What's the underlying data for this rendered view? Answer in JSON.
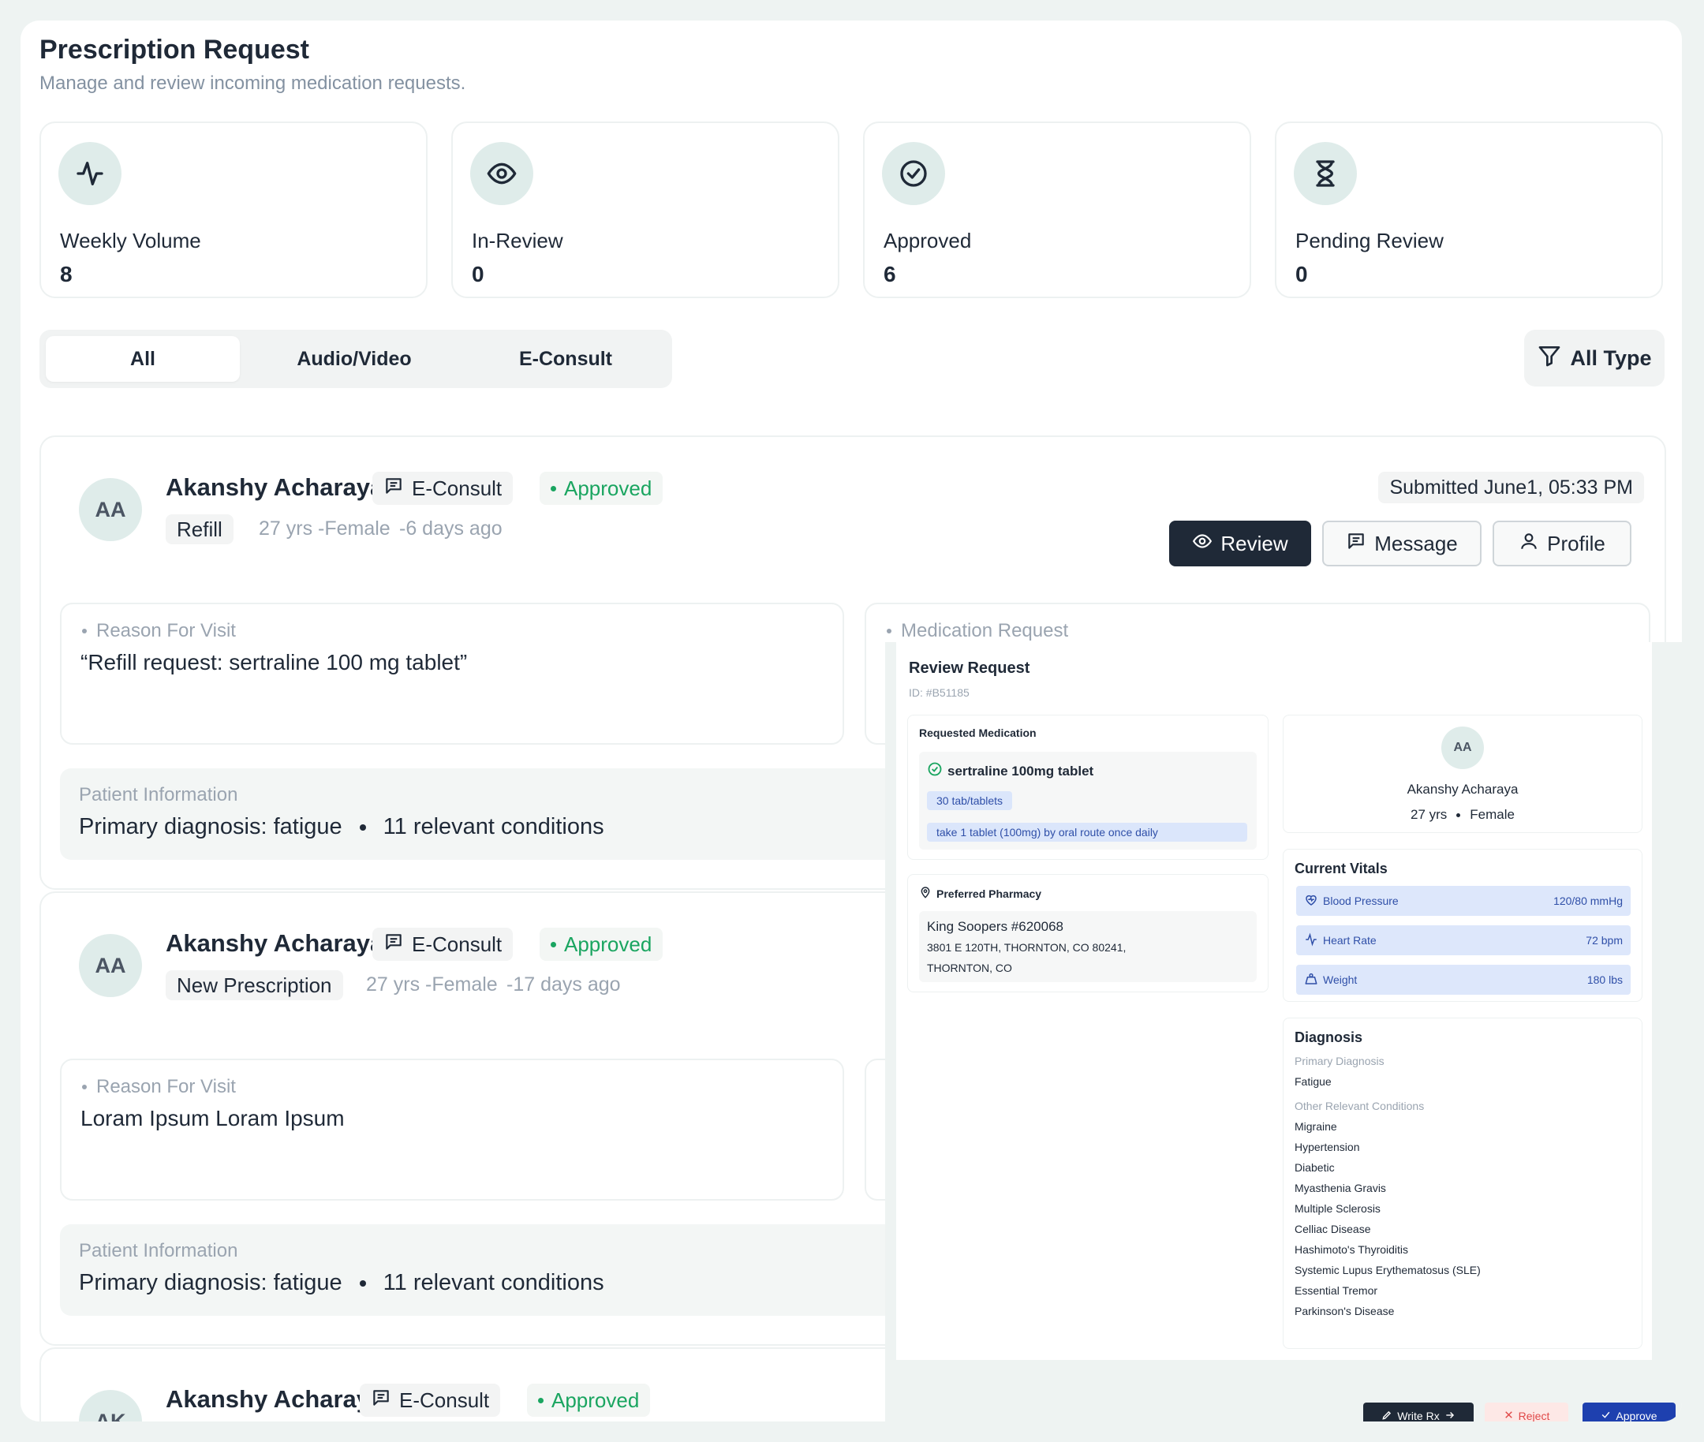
{
  "header": {
    "title": "Prescription Request",
    "subtitle": "Manage and review incoming medication requests."
  },
  "stats": [
    {
      "icon": "activity-icon",
      "label": "Weekly Volume",
      "value": "8"
    },
    {
      "icon": "eye-icon",
      "label": "In-Review",
      "value": "0"
    },
    {
      "icon": "check-circle-icon",
      "label": "Approved",
      "value": "6"
    },
    {
      "icon": "hourglass-icon",
      "label": "Pending Review",
      "value": "0"
    }
  ],
  "tabs": [
    "All",
    "Audio/Video",
    "E-Consult"
  ],
  "active_tab": "All",
  "filter_label": "All Type",
  "requests": [
    {
      "initials": "AA",
      "name": "Akanshy Acharaya",
      "consult_type": "E-Consult",
      "status": "Approved",
      "request_type": "Refill",
      "demographics": "27 yrs -Female",
      "age_ago": "-6 days ago",
      "submitted": "Submitted June1, 05:33 PM",
      "buttons": {
        "review": "Review",
        "message": "Message",
        "profile": "Profile"
      },
      "reason_label": "Reason For Visit",
      "reason": "“Refill request: sertraline 100 mg tablet”",
      "medication_label": "Medication Request",
      "patient_info_label": "Patient Information",
      "primary_diagnosis": "Primary diagnosis: fatigue",
      "conditions": "11 relevant conditions"
    },
    {
      "initials": "AA",
      "name": "Akanshy Acharaya",
      "consult_type": "E-Consult",
      "status": "Approved",
      "request_type": "New Prescription",
      "demographics": "27 yrs -Female",
      "age_ago": "-17 days ago",
      "reason_label": "Reason For Visit",
      "reason": "Loram Ipsum Loram Ipsum",
      "patient_info_label": "Patient Information",
      "primary_diagnosis": "Primary diagnosis: fatigue",
      "conditions": "11 relevant conditions"
    },
    {
      "initials": "AK",
      "name": "Akanshy Acharay",
      "consult_type": "E-Consult",
      "status": "Approved"
    }
  ],
  "review_panel": {
    "title": "Review Request",
    "id": "ID: #B51185",
    "requested_medication_label": "Requested Medication",
    "medication_name": "sertraline 100mg tablet",
    "quantity": "30 tab/tablets",
    "directions": "take 1 tablet (100mg) by oral route once daily",
    "pharmacy_label": "Preferred Pharmacy",
    "pharmacy_name": "King Soopers #620068",
    "pharmacy_address_1": "3801 E 120TH, THORNTON, CO 80241,",
    "pharmacy_address_2": "THORNTON, CO",
    "patient_initials": "AA",
    "patient_name": "Akanshy Acharaya",
    "patient_age": "27 yrs",
    "patient_gender": "Female",
    "vitals_label": "Current Vitals",
    "vitals": [
      {
        "icon": "heart-pulse-icon",
        "label": "Blood Pressure",
        "value": "120/80 mmHg"
      },
      {
        "icon": "activity-icon",
        "label": "Heart Rate",
        "value": "72 bpm"
      },
      {
        "icon": "weight-icon",
        "label": "Weight",
        "value": "180 lbs"
      }
    ],
    "diagnosis_label": "Diagnosis",
    "primary_diagnosis_label": "Primary Diagnosis",
    "primary_diagnosis": "Fatigue",
    "other_conditions_label": "Other Relevant Conditions",
    "conditions": [
      "Migraine",
      "Hypertension",
      "Diabetic",
      "Myasthenia Gravis",
      "Multiple Sclerosis",
      "Celliac Disease",
      "Hashimoto's Thyroiditis",
      "Systemic Lupus Erythematosus (SLE)",
      "Essential Tremor",
      "Parkinson's Disease"
    ],
    "actions": {
      "write_rx": "Write Rx",
      "reject": "Reject",
      "approve": "Approve"
    }
  },
  "colors": {
    "accent_dark": "#1f2937",
    "approved_green": "#1aa560",
    "approve_blue": "#1e40af",
    "reject_red": "#e04848",
    "icon_bg": "#dfecea"
  }
}
